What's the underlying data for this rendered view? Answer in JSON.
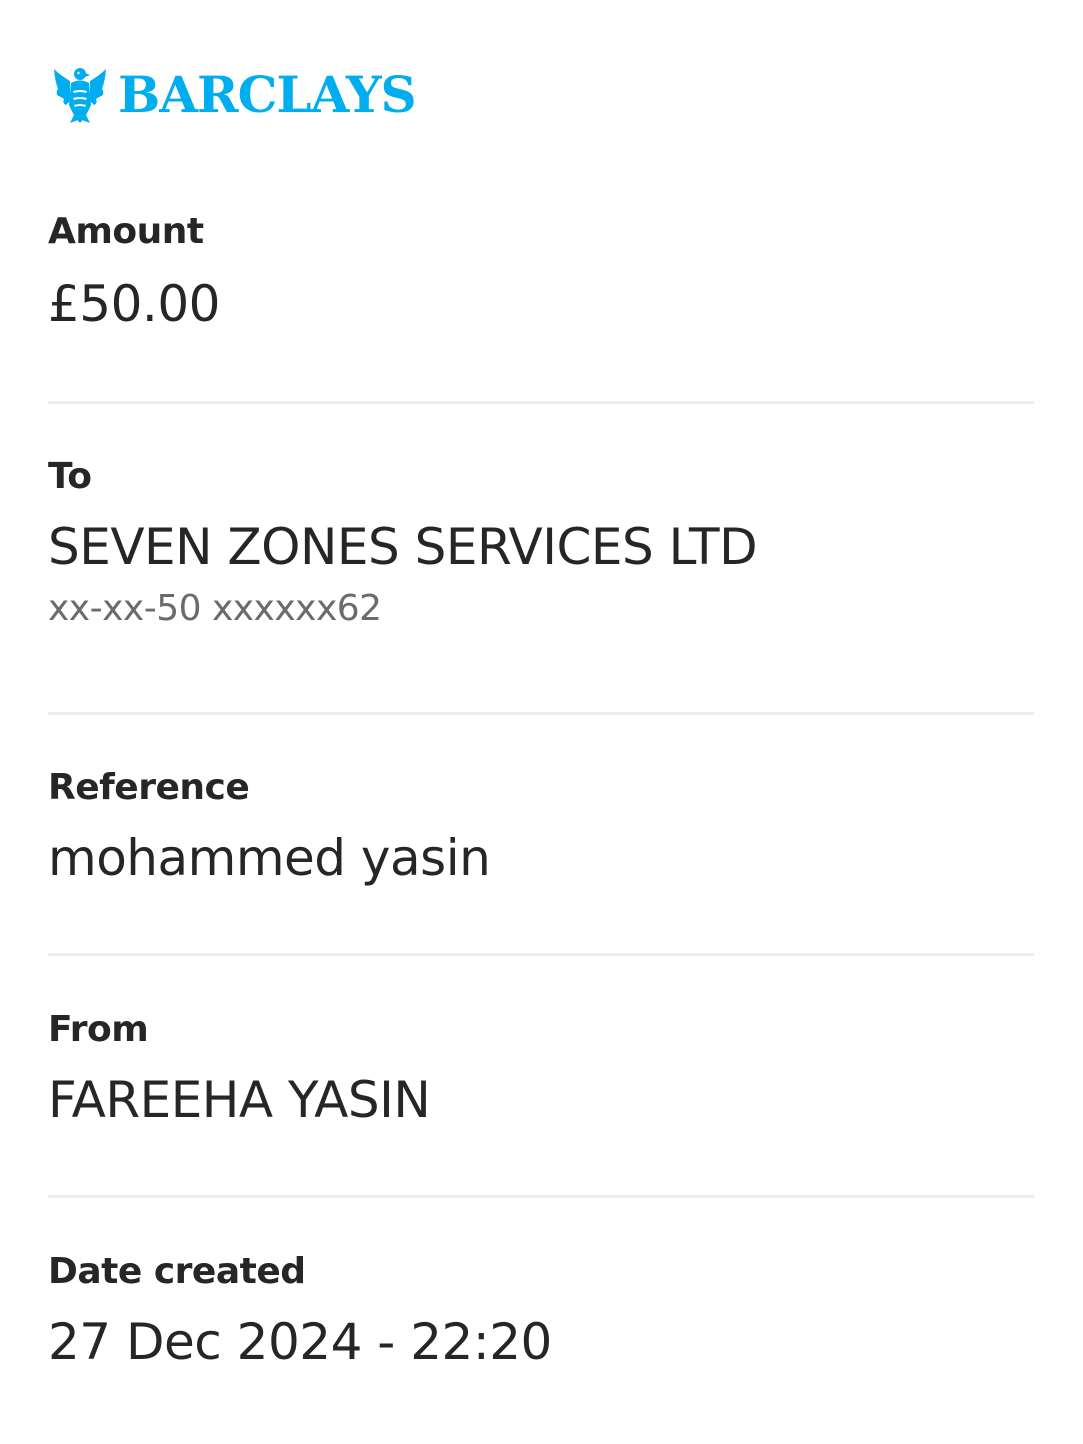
{
  "brand": {
    "name": "BARCLAYS",
    "logo_icon": "eagle-icon",
    "color": "#00aeef"
  },
  "amount": {
    "label": "Amount",
    "value": "£50.00"
  },
  "to": {
    "label": "To",
    "name": "SEVEN ZONES SERVICES LTD",
    "account": "xx-xx-50 xxxxxx62"
  },
  "reference": {
    "label": "Reference",
    "value": "mohammed yasin"
  },
  "from": {
    "label": "From",
    "value": "FAREEHA YASIN"
  },
  "date_created": {
    "label": "Date created",
    "value": "27 Dec 2024 - 22:20"
  }
}
